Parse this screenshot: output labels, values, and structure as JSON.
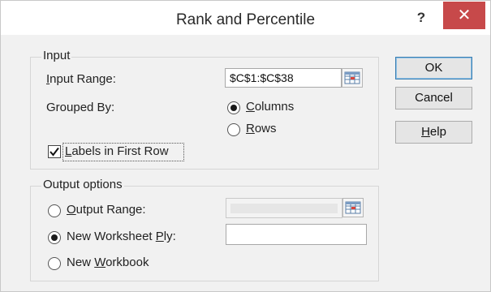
{
  "dialog": {
    "title": "Rank and Percentile",
    "help_glyph": "?",
    "close_glyph": "✕",
    "close_color": "#c7494a"
  },
  "input": {
    "group_label": "Input",
    "range_label_pre": "",
    "range_label_ul": "I",
    "range_label_post": "nput Range:",
    "range_value": "$C$1:$C$38",
    "grouped_by_label": "Grouped By:",
    "columns_ul": "C",
    "columns_post": "olumns",
    "rows_ul": "R",
    "rows_post": "ows",
    "grouped_by_selected": "Columns",
    "labels_ul": "L",
    "labels_post": "abels in First Row",
    "labels_checked": true
  },
  "output": {
    "group_label": "Output options",
    "output_range_ul": "O",
    "output_range_post": "utput Range:",
    "output_range_value": "",
    "new_ply_pre": "New Worksheet ",
    "new_ply_ul": "P",
    "new_ply_post": "ly:",
    "new_ply_value": "",
    "new_workbook_pre": "New ",
    "new_workbook_ul": "W",
    "new_workbook_post": "orkbook",
    "selected": "New Worksheet Ply"
  },
  "buttons": {
    "ok": "OK",
    "cancel": "Cancel",
    "help_ul": "H",
    "help_post": "elp"
  },
  "icons": {
    "help": "question-mark-icon",
    "close": "close-icon",
    "range_picker": "range-select-icon"
  }
}
